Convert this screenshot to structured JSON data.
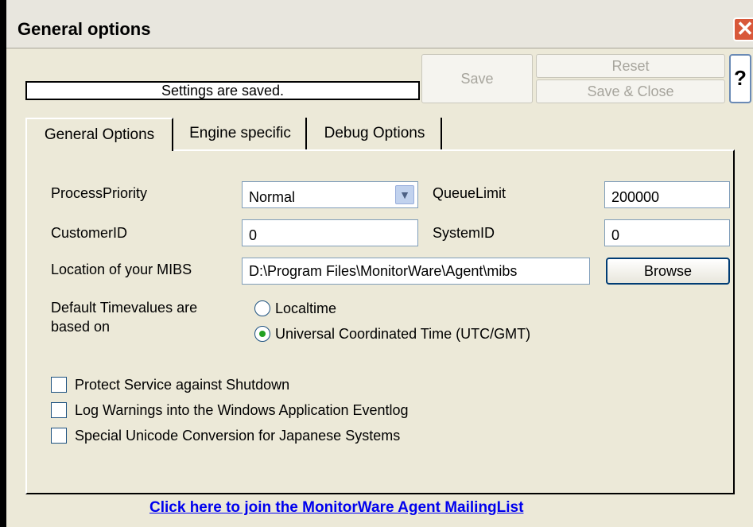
{
  "window": {
    "title": "General options",
    "close_glyph": "✕"
  },
  "status": {
    "text": "Settings are saved."
  },
  "toolbar": {
    "save_label": "Save",
    "reset_label": "Reset",
    "save_close_label": "Save & Close",
    "help_label": "?"
  },
  "tabs": [
    {
      "label": "General Options",
      "active": true
    },
    {
      "label": "Engine specific",
      "active": false
    },
    {
      "label": "Debug Options",
      "active": false
    }
  ],
  "form": {
    "process_priority": {
      "label": "ProcessPriority",
      "value": "Normal"
    },
    "queue_limit": {
      "label": "QueueLimit",
      "value": "200000"
    },
    "customer_id": {
      "label": "CustomerID",
      "value": "0"
    },
    "system_id": {
      "label": "SystemID",
      "value": "0"
    },
    "mibs": {
      "label": "Location of your MIBS",
      "value": "D:\\Program Files\\MonitorWare\\Agent\\mibs",
      "browse_label": "Browse"
    },
    "timevalues": {
      "label_line1": "Default Timevalues are",
      "label_line2": "based on",
      "options": [
        {
          "label": "Localtime",
          "selected": false
        },
        {
          "label": "Universal Coordinated Time (UTC/GMT)",
          "selected": true
        }
      ]
    },
    "checkboxes": [
      {
        "label": "Protect Service against Shutdown",
        "checked": false
      },
      {
        "label": "Log Warnings into the Windows Application Eventlog",
        "checked": false
      },
      {
        "label": "Special Unicode Conversion for Japanese Systems",
        "checked": false
      }
    ]
  },
  "footer": {
    "link_text": "Click here to join the MonitorWare Agent MailingList"
  },
  "icons": {
    "close": "close-icon",
    "dropdown": "chevron-down-icon"
  },
  "colors": {
    "accent": "#003c74",
    "close_button": "#d8583a",
    "radio_dot": "#21a121",
    "link": "#0000ee"
  }
}
